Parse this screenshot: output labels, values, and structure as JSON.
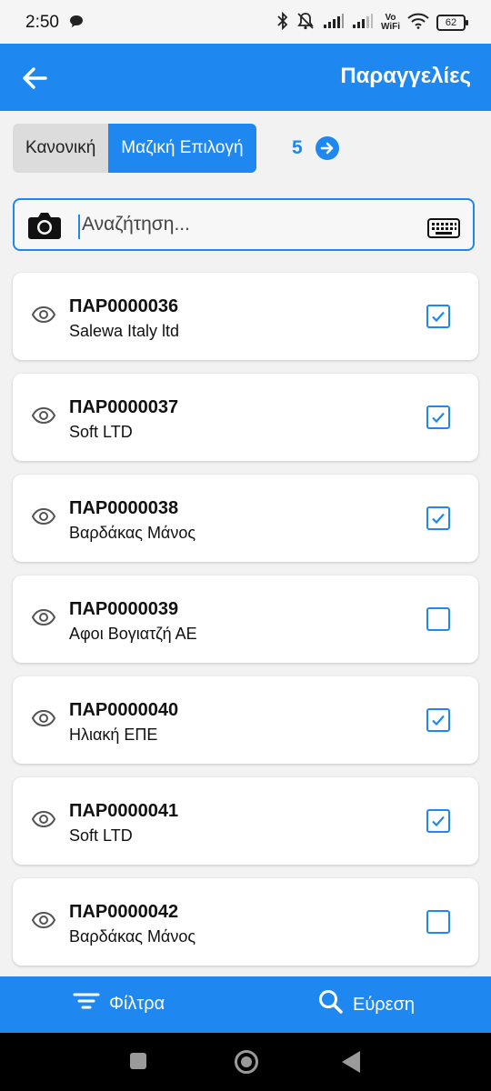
{
  "status_bar": {
    "time": "2:50",
    "wifi_label_top": "Vo",
    "wifi_label_bottom": "WiFi",
    "battery": "62",
    "icons": [
      "chat-icon",
      "bluetooth-icon",
      "mute-icon",
      "signal-icon",
      "signal-icon",
      "wifi-icon",
      "battery-icon"
    ]
  },
  "app_bar": {
    "title": "Παραγγελίες",
    "back_icon": "arrow-left-icon"
  },
  "mode_toggle": {
    "options": [
      "Κανονική",
      "Μαζική Επιλογή"
    ],
    "selected": "Μαζική Επιλογή"
  },
  "selection": {
    "count": "5",
    "go_icon": "arrow-right-circle-icon"
  },
  "search": {
    "placeholder": "Αναζήτηση...",
    "value": "",
    "left_icon": "camera-icon",
    "right_icon": "keyboard-icon"
  },
  "orders": [
    {
      "code": "ΠΑΡ0000036",
      "customer": "Salewa Italy ltd",
      "checked": true
    },
    {
      "code": "ΠΑΡ0000037",
      "customer": "Soft LTD",
      "checked": true
    },
    {
      "code": "ΠΑΡ0000038",
      "customer": "Βαρδάκας Μάνος",
      "checked": true
    },
    {
      "code": "ΠΑΡ0000039",
      "customer": "Αφοι Βογιατζή ΑΕ",
      "checked": false
    },
    {
      "code": "ΠΑΡ0000040",
      "customer": "Ηλιακή ΕΠΕ",
      "checked": true
    },
    {
      "code": "ΠΑΡ0000041",
      "customer": "Soft LTD",
      "checked": true
    },
    {
      "code": "ΠΑΡ0000042",
      "customer": "Βαρδάκας Μάνος",
      "checked": false
    }
  ],
  "bottom_bar": {
    "filter_label": "Φίλτρα",
    "search_label": "Εύρεση"
  },
  "colors": {
    "accent": "#1e88f0",
    "toggle_inactive": "#dcdcdc",
    "background": "#f2f2f2"
  }
}
